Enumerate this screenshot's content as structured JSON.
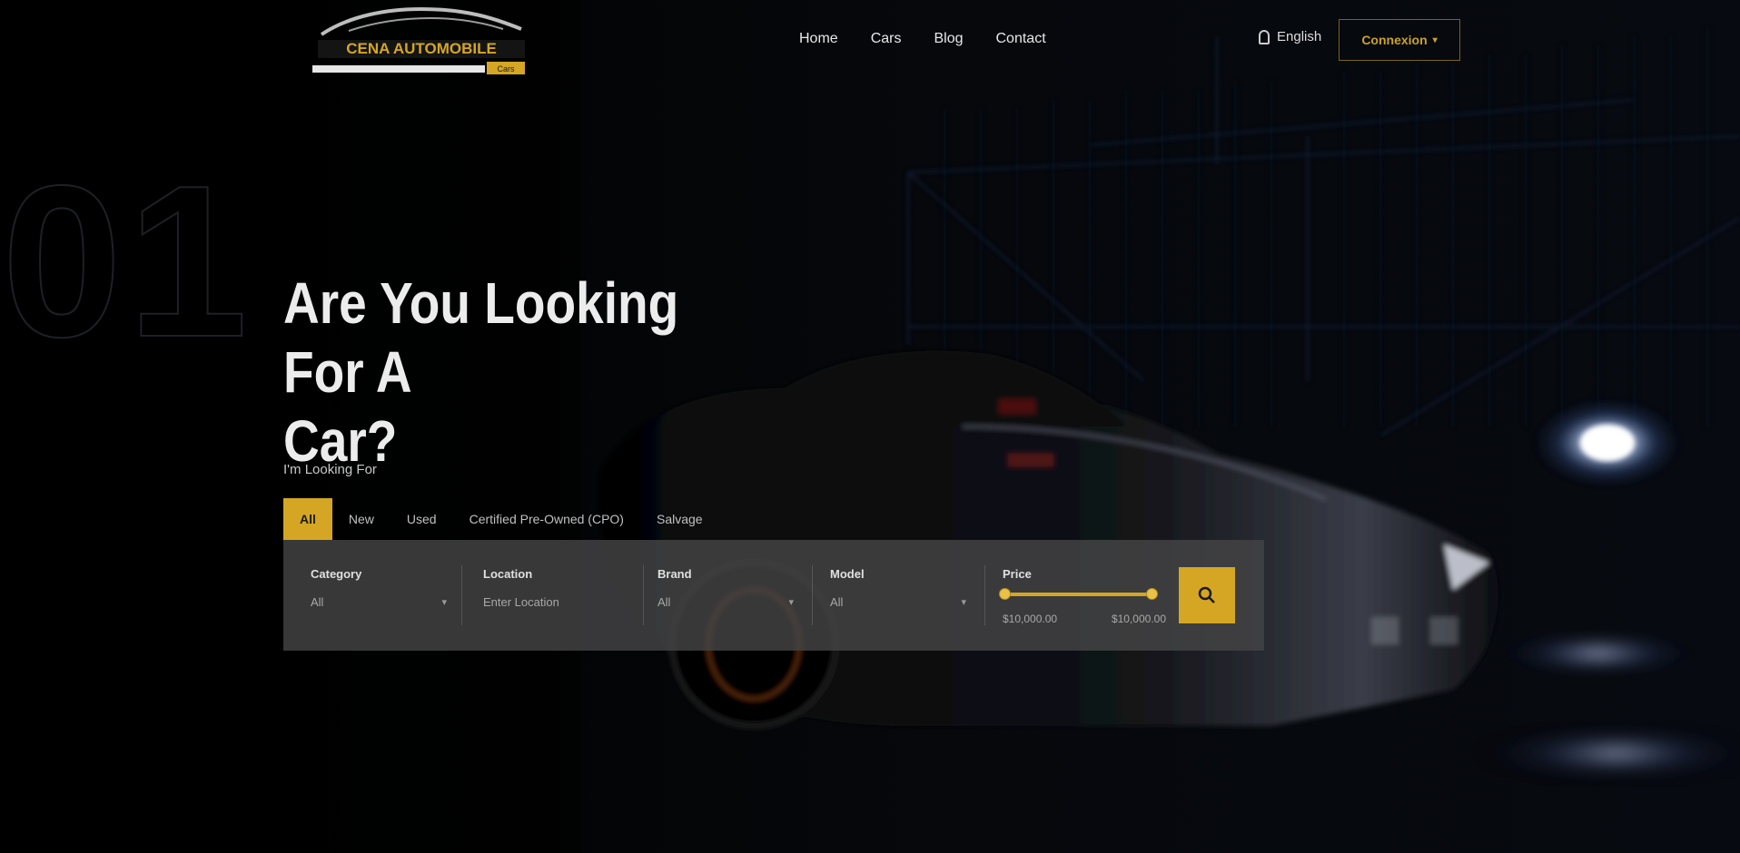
{
  "header": {
    "logo_text": "CENA AUTOMOBILE",
    "logo_subtext": "Cars",
    "nav": [
      "Home",
      "Cars",
      "Blog",
      "Contact"
    ],
    "language": "English",
    "login_label": "Connexion"
  },
  "hero": {
    "slide_number": "01",
    "headline_line1": "Are You Looking For A",
    "headline_line2": "Car?",
    "looking_for_label": "I'm Looking For"
  },
  "tabs": [
    {
      "label": "All",
      "active": true
    },
    {
      "label": "New",
      "active": false
    },
    {
      "label": "Used",
      "active": false
    },
    {
      "label": "Certified Pre-Owned (CPO)",
      "active": false
    },
    {
      "label": "Salvage",
      "active": false
    }
  ],
  "search": {
    "category": {
      "label": "Category",
      "value": "All"
    },
    "location": {
      "label": "Location",
      "placeholder": "Enter Location"
    },
    "brand": {
      "label": "Brand",
      "value": "All"
    },
    "model": {
      "label": "Model",
      "value": "All"
    },
    "price": {
      "label": "Price",
      "min": "$10,000.00",
      "max": "$10,000.00",
      "range_fill_fraction": 1.0
    }
  },
  "colors": {
    "accent": "#d4a623",
    "background": "#000000",
    "panel": "#444446",
    "text": "#ececec"
  },
  "icons": {
    "language": "globe-icon",
    "login": "chevron-down-icon",
    "search": "search-icon",
    "dropdown": "chevron-down-icon"
  }
}
